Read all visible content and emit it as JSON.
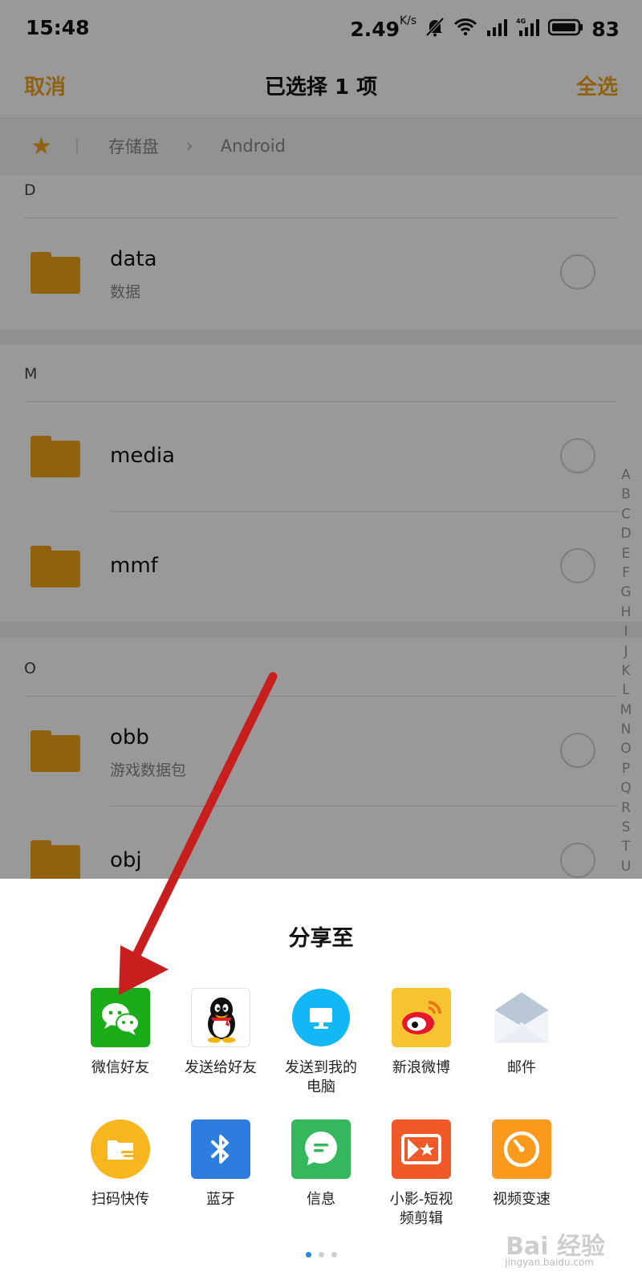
{
  "status_bar": {
    "time": "15:48",
    "net_speed": "2.49",
    "net_speed_unit": "K/s",
    "battery": "83"
  },
  "title_bar": {
    "cancel": "取消",
    "title": "已选择 1 项",
    "select_all": "全选"
  },
  "breadcrumb": {
    "storage": "存储盘",
    "folder": "Android"
  },
  "sections": {
    "d": "D",
    "m": "M",
    "o": "O"
  },
  "files": {
    "data": {
      "name": "data",
      "sub": "数据"
    },
    "media": {
      "name": "media"
    },
    "mmf": {
      "name": "mmf"
    },
    "obb": {
      "name": "obb",
      "sub": "游戏数据包"
    },
    "obj": {
      "name": "obj"
    }
  },
  "index_letters": [
    "A",
    "B",
    "C",
    "D",
    "E",
    "F",
    "G",
    "H",
    "I",
    "J",
    "K",
    "L",
    "M",
    "N",
    "O",
    "P",
    "Q",
    "R",
    "S",
    "T",
    "U"
  ],
  "share": {
    "title": "分享至",
    "apps": [
      {
        "label": "微信好友",
        "icon": "wechat-icon"
      },
      {
        "label": "发送给好友",
        "icon": "qq-icon"
      },
      {
        "label_line1": "发送到我的",
        "label_line2": "电脑",
        "icon": "computer-icon"
      },
      {
        "label": "新浪微博",
        "icon": "weibo-icon"
      },
      {
        "label": "邮件",
        "icon": "mail-icon"
      },
      {
        "label": "扫码快传",
        "icon": "quick-transfer-icon"
      },
      {
        "label": "蓝牙",
        "icon": "bluetooth-icon"
      },
      {
        "label": "信息",
        "icon": "message-icon"
      },
      {
        "label_line1": "小影-短视",
        "label_line2": "频剪辑",
        "icon": "video-editor-icon"
      },
      {
        "label": "视频变速",
        "icon": "video-speed-icon"
      }
    ],
    "page_count": 3,
    "active_page": 1
  },
  "colors": {
    "accent": "#f0a41b",
    "wechat": "#1aad19",
    "annotation_arrow": "#c81e1e"
  },
  "watermark": {
    "text": "Bai 经验",
    "sub": "jingyan.baidu.com"
  }
}
